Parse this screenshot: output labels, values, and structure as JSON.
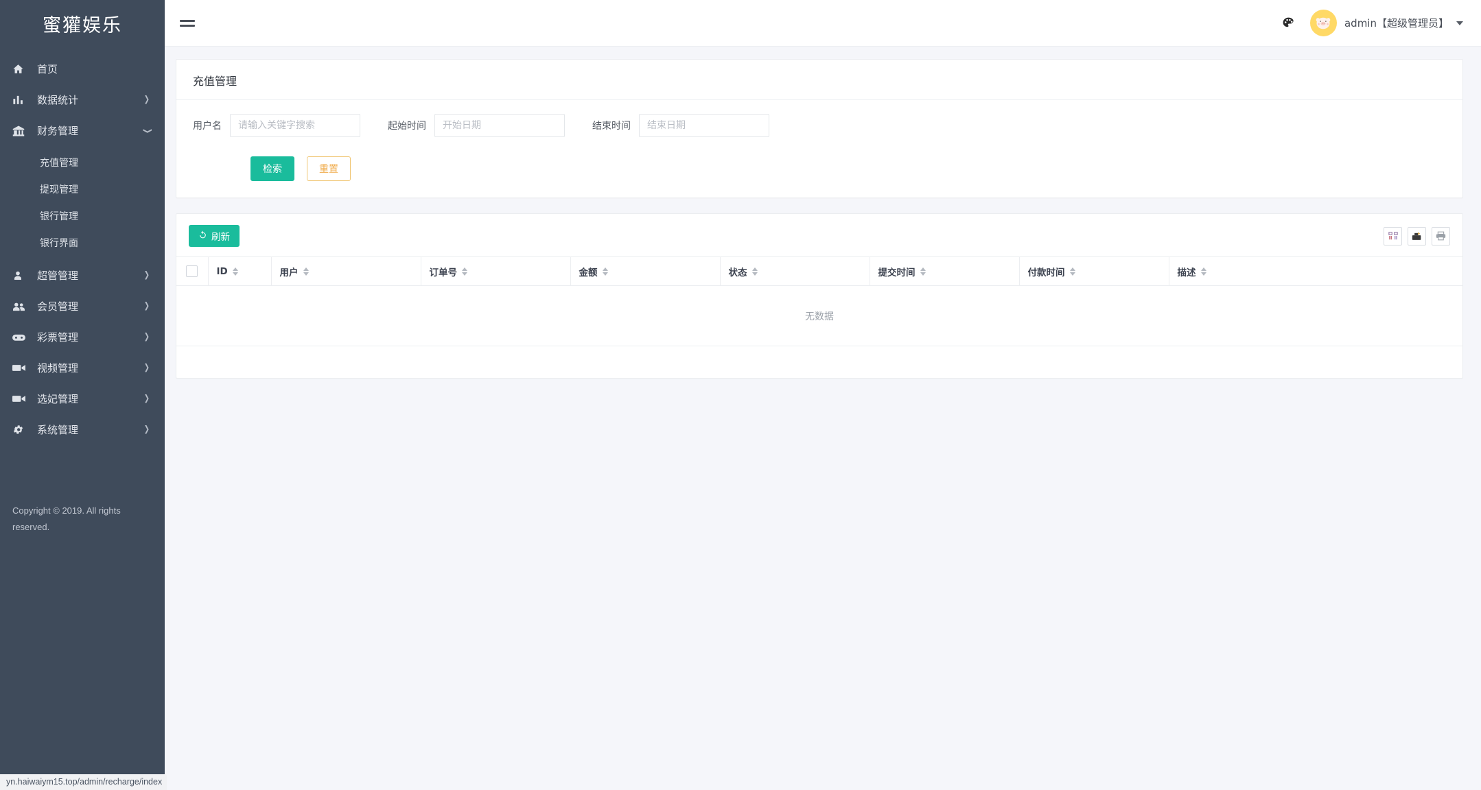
{
  "sidebar": {
    "brand": "蜜獾娱乐",
    "items": [
      {
        "label": "首页",
        "icon": "home-icon",
        "expandable": false
      },
      {
        "label": "数据统计",
        "icon": "chart-bar-icon",
        "expandable": true,
        "open": false
      },
      {
        "label": "财务管理",
        "icon": "bank-icon",
        "expandable": true,
        "open": true
      },
      {
        "label": "超管管理",
        "icon": "user-icon",
        "expandable": true,
        "open": false
      },
      {
        "label": "会员管理",
        "icon": "users-icon",
        "expandable": true,
        "open": false
      },
      {
        "label": "彩票管理",
        "icon": "gamepad-icon",
        "expandable": true,
        "open": false
      },
      {
        "label": "视频管理",
        "icon": "video-camera-icon",
        "expandable": true,
        "open": false
      },
      {
        "label": "选妃管理",
        "icon": "video-camera-icon",
        "expandable": true,
        "open": false
      },
      {
        "label": "系统管理",
        "icon": "gear-icon",
        "expandable": true,
        "open": false
      }
    ],
    "finance_submenu": [
      "充值管理",
      "提现管理",
      "银行管理",
      "银行界面"
    ],
    "copyright": "Copyright © 2019. All rights reserved."
  },
  "topbar": {
    "menu_toggle": "hamburger-icon",
    "palette_icon": "palette-icon",
    "avatar_icon": "user-avatar",
    "user_label": "admin【超级管理员】"
  },
  "search_card": {
    "title": "充值管理",
    "fields": [
      {
        "label": "用户名",
        "placeholder": "请输入关键字搜索",
        "value": ""
      },
      {
        "label": "起始时间",
        "placeholder": "开始日期",
        "value": ""
      },
      {
        "label": "结束时间",
        "placeholder": "结束日期",
        "value": ""
      }
    ],
    "search_button": "检索",
    "reset_button": "重置"
  },
  "table_card": {
    "refresh_button": "刷新",
    "tool_icons": [
      "columns-icon",
      "export-icon",
      "print-icon"
    ],
    "columns": [
      "ID",
      "用户",
      "订单号",
      "金额",
      "状态",
      "提交时间",
      "付款时间",
      "描述"
    ],
    "empty_text": "无数据"
  },
  "statusbar": {
    "url": "yn.haiwaiym15.top/admin/recharge/index"
  },
  "colors": {
    "sidebar_bg": "#3f4b5b",
    "accent_teal": "#1abc9c",
    "accent_yellow": "#f0ad4e",
    "avatar_bg": "#ffd966",
    "page_bg": "#f5f6fa"
  }
}
